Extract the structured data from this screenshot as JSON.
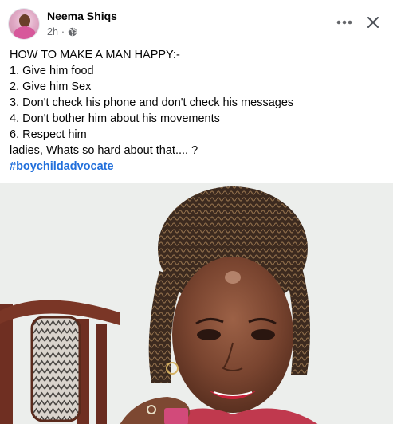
{
  "post": {
    "author": "Neema Shiqs",
    "timestamp": "2h",
    "privacy_icon": "globe-icon",
    "lines": [
      "HOW TO MAKE A MAN HAPPY:-",
      "1. Give him food",
      "2. Give him Sex",
      "3. Don't check his phone and don't check his messages",
      "4. Don't bother him about his movements",
      "6. Respect him",
      "ladies, Whats so hard about that.... ?"
    ],
    "hashtag": "#boychildadvocate"
  },
  "header": {
    "more_icon": "more-horizontal-icon",
    "close_icon": "close-icon"
  },
  "colors": {
    "hashtag": "#216fdb",
    "meta_text": "#65676b",
    "text": "#050505"
  }
}
